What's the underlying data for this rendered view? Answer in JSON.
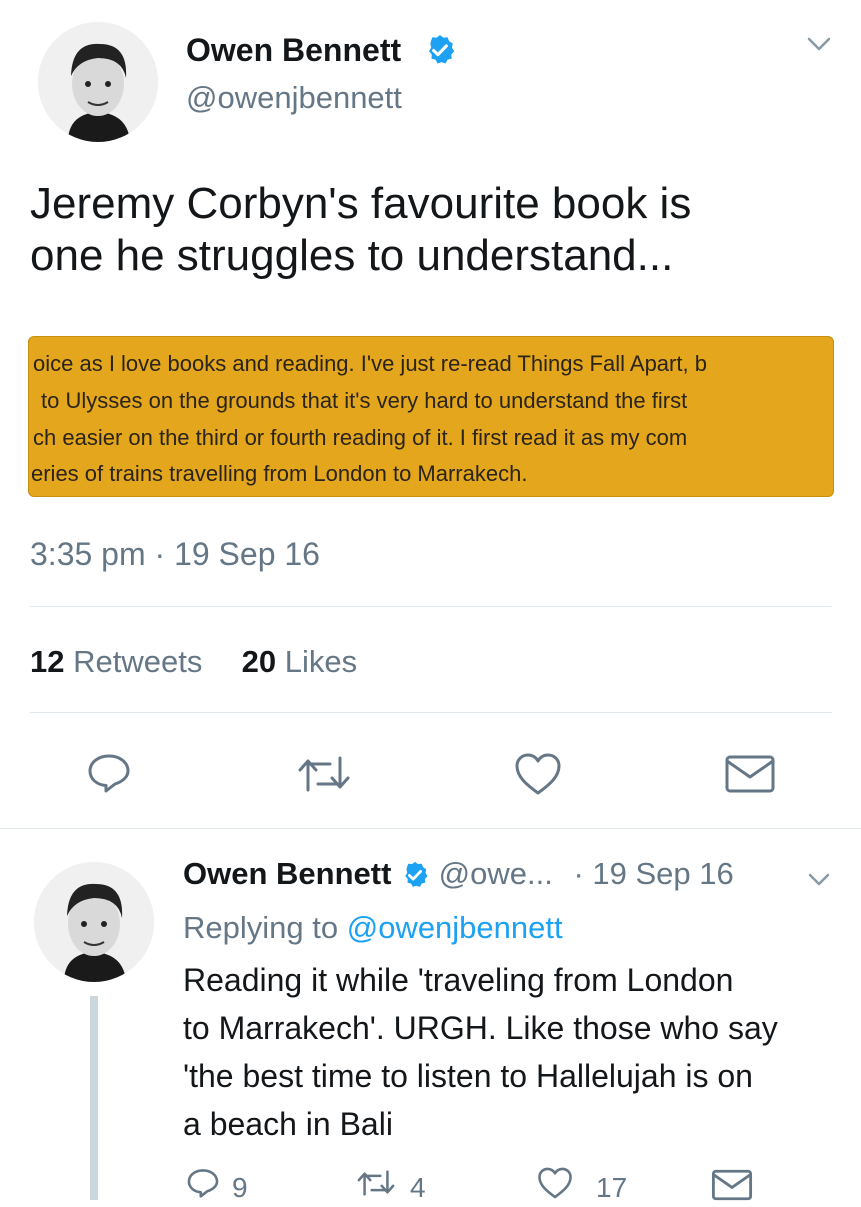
{
  "main_tweet": {
    "author_name": "Owen Bennett",
    "author_handle": "@owenjbennett",
    "text_line1": "Jeremy Corbyn's favourite book is",
    "text_line2": "one he struggles to understand...",
    "image_lines": [
      "oice as I love books and reading. I've just re-read Things Fall Apart, b",
      "to Ulysses on the grounds that it's very hard to understand the first",
      "ch easier on the third or fourth reading of it. I first read it as my com",
      "eries of trains travelling from London to Marrakech."
    ],
    "image_bg_color": "#e3a61d",
    "timestamp": "3:35 pm · 19 Sep 16",
    "retweet_count": "12",
    "retweets_label": "Retweets",
    "like_count": "20",
    "likes_label": "Likes"
  },
  "reply_tweet": {
    "author_name": "Owen Bennett",
    "author_handle": "@owe...",
    "date": "· 19 Sep 16",
    "replying_prefix": "Replying to",
    "replying_handle": "@owenjbennett",
    "text_lines": [
      "Reading it while 'traveling from London",
      "to Marrakech'. URGH. Like those who say",
      "'the best time to listen to Hallelujah is on",
      "a beach in Bali"
    ],
    "reply_count": "9",
    "retweet_count": "4",
    "like_count": "17"
  },
  "colors": {
    "accent": "#1da1f2",
    "muted": "#657786",
    "divider": "#e1e8ed"
  },
  "icons": {
    "verified": "verified-badge-icon",
    "chevron": "chevron-down-icon",
    "reply": "reply-icon",
    "retweet": "retweet-icon",
    "like": "heart-icon",
    "dm": "envelope-icon"
  }
}
